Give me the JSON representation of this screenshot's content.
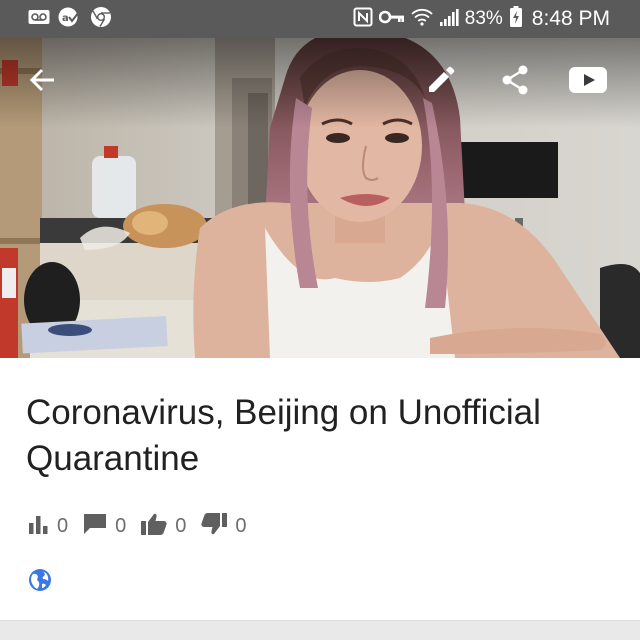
{
  "status_bar": {
    "battery_percent": "83%",
    "time": "8:48 PM",
    "left_icons": [
      "voicemail-icon",
      "accessibility-check-icon",
      "chrome-icon"
    ],
    "right_icons": [
      "nfc-icon",
      "vpn-key-icon",
      "wifi-icon",
      "signal-icon",
      "battery-charging-icon"
    ]
  },
  "top_bar": {
    "icons": [
      "back-arrow-icon",
      "edit-pencil-icon",
      "share-icon",
      "youtube-icon"
    ]
  },
  "video": {
    "title": "Coronavirus, Beijing on Unofficial Quarantine",
    "stats": {
      "views": "0",
      "comments": "0",
      "likes": "0",
      "dislikes": "0"
    },
    "privacy_icon": "globe-public-icon",
    "colors": {
      "privacy_icon": "#3b78e7",
      "stat_icon": "#5f5f5f"
    }
  }
}
